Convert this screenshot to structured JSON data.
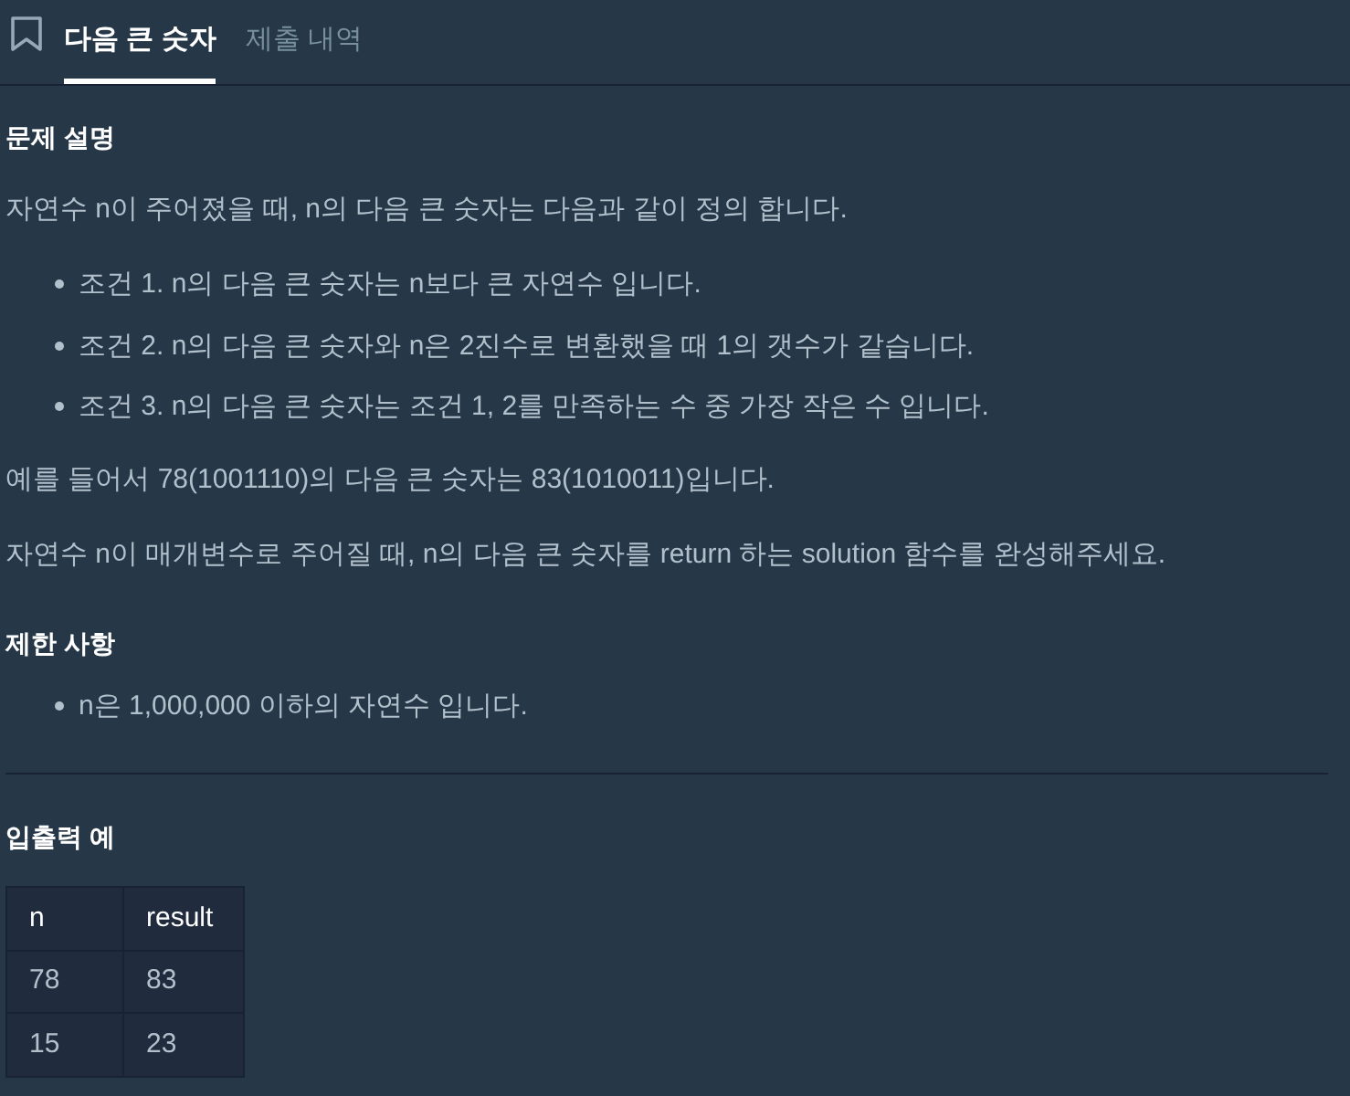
{
  "tabs": [
    {
      "label": "다음 큰 숫자",
      "selected": true
    },
    {
      "label": "제출 내역",
      "selected": false
    }
  ],
  "sections": [
    {
      "heading": "문제 설명",
      "blocks": [
        {
          "kind": "paragraph",
          "text": "자연수 n이 주어졌을 때, n의 다음 큰 숫자는 다음과 같이 정의 합니다."
        },
        {
          "kind": "list",
          "items": [
            "조건 1. n의 다음 큰 숫자는 n보다 큰 자연수 입니다.",
            "조건 2. n의 다음 큰 숫자와 n은 2진수로 변환했을 때 1의 갯수가 같습니다.",
            "조건 3. n의 다음 큰 숫자는 조건 1, 2를 만족하는 수 중 가장 작은 수 입니다."
          ]
        },
        {
          "kind": "paragraph",
          "text": "예를 들어서 78(1001110)의 다음 큰 숫자는 83(1010011)입니다."
        },
        {
          "kind": "paragraph",
          "text": "자연수 n이 매개변수로 주어질 때, n의 다음 큰 숫자를 return 하는 solution 함수를 완성해주세요."
        }
      ]
    },
    {
      "heading": "제한 사항",
      "blocks": [
        {
          "kind": "list",
          "items": [
            "n은 1,000,000 이하의 자연수 입니다."
          ]
        }
      ]
    }
  ],
  "examples": {
    "heading": "입출력 예",
    "columns": [
      "n",
      "result"
    ],
    "rows": [
      [
        "78",
        "83"
      ],
      [
        "15",
        "23"
      ]
    ]
  }
}
